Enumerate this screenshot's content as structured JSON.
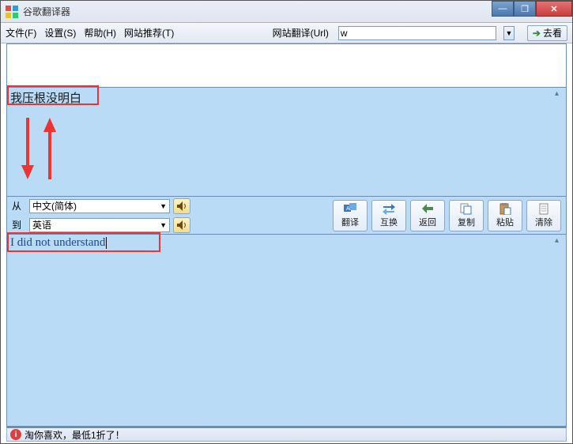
{
  "title": "谷歌翻译器",
  "menu": {
    "file": "文件(F)",
    "settings": "设置(S)",
    "help": "帮助(H)",
    "recommend": "网站推荐(T)"
  },
  "url_section": {
    "label": "网站翻译(Url)",
    "value": "w",
    "go": "去看"
  },
  "source_text": "我压根没明白",
  "lang": {
    "from_label": "从",
    "from_value": "中文(简体)",
    "to_label": "到",
    "to_value": "英语"
  },
  "toolbar": {
    "translate": "翻译",
    "swap": "互换",
    "back": "返回",
    "copy": "复制",
    "paste": "粘贴",
    "clear": "清除"
  },
  "result_text": "I did not understand",
  "status": "淘你喜欢，最低1折了！",
  "win": {
    "min": "—",
    "max": "❐",
    "close": "✕"
  }
}
